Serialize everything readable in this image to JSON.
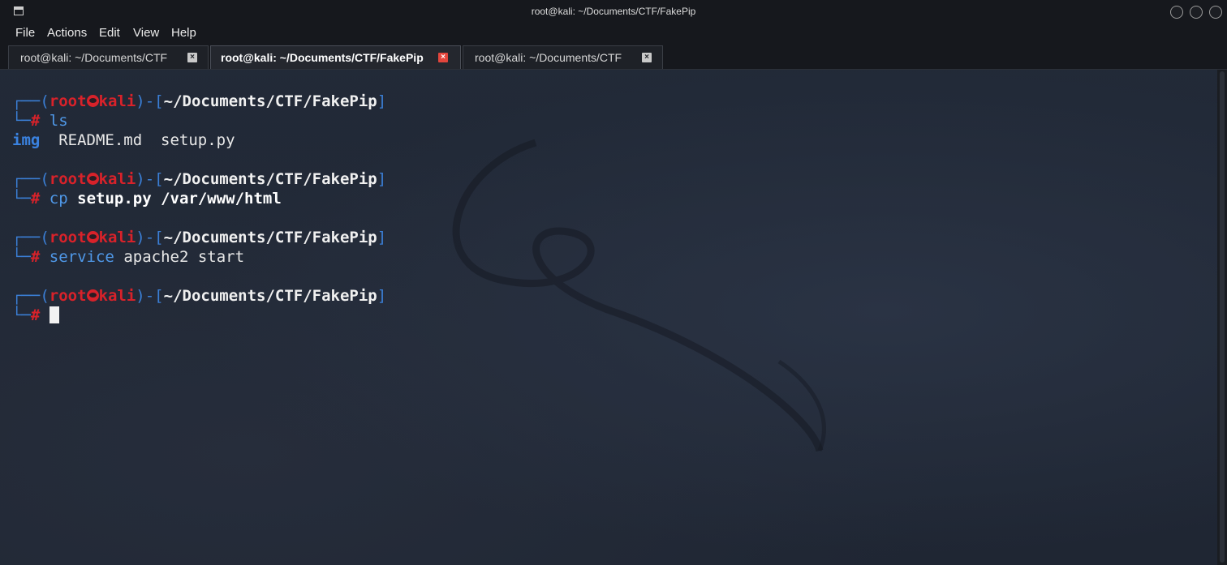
{
  "window": {
    "title": "root@kali: ~/Documents/CTF/FakePip"
  },
  "menu": [
    "File",
    "Actions",
    "Edit",
    "View",
    "Help"
  ],
  "tabs": [
    {
      "label": "root@kali: ~/Documents/CTF",
      "active": false
    },
    {
      "label": "root@kali: ~/Documents/CTF/FakePip",
      "active": true
    },
    {
      "label": "root@kali: ~/Documents/CTF",
      "active": false
    }
  ],
  "terminal": {
    "prompt": {
      "corner_top": "┌──(",
      "user": "root",
      "host": "kali",
      "mid": ")-[",
      "path": "~/Documents/CTF/FakePip",
      "close": "]",
      "corner_bottom": "└─",
      "hash": "#"
    },
    "blocks": [
      {
        "cmd_word": "ls",
        "cmd_rest": "",
        "output": {
          "dir": "img",
          "files": "  README.md  setup.py"
        }
      },
      {
        "cmd_word": "cp",
        "cmd_rest": " setup.py /var/www/html"
      },
      {
        "cmd_word": "service",
        "cmd_rest": " apache2 start"
      },
      {
        "cmd_word": "",
        "cmd_rest": ""
      }
    ]
  },
  "colors": {
    "prompt_blue": "#3b7fd6",
    "prompt_red": "#d8222a",
    "background": "#1f2633"
  }
}
